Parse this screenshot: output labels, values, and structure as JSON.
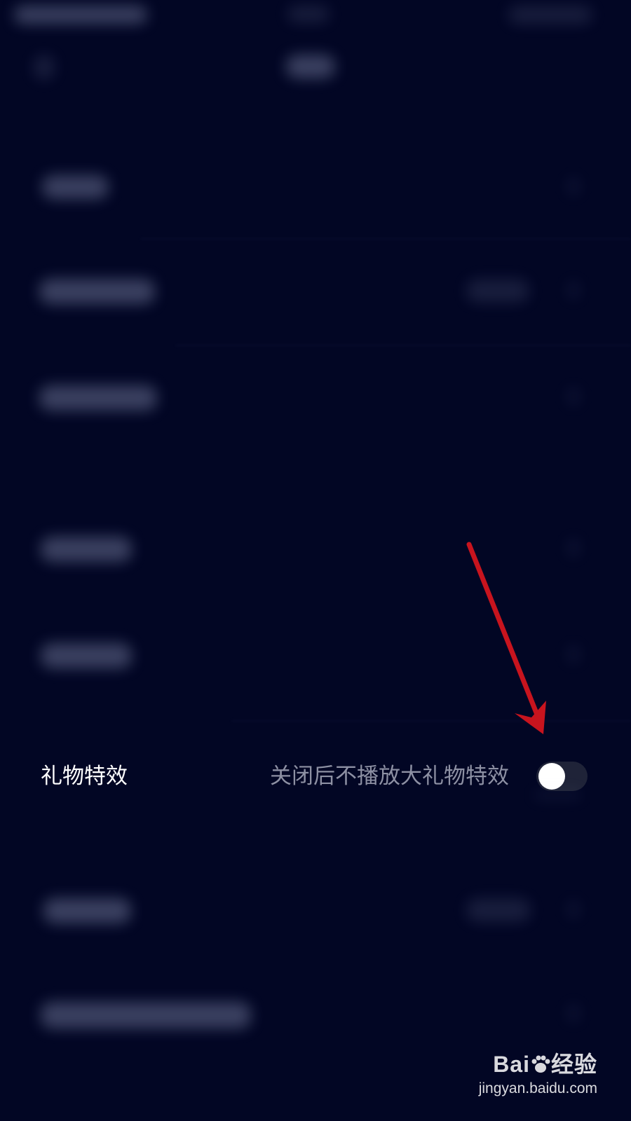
{
  "gift_effects": {
    "title": "礼物特效",
    "description": "关闭后不播放大礼物特效",
    "toggle_on": false
  },
  "watermark": {
    "brand": "Bai",
    "brand_suffix": "经验",
    "url": "jingyan.baidu.com"
  },
  "colors": {
    "background": "#020624",
    "title_text": "#ffffff",
    "description_text": "#8d90a3",
    "toggle_track_off": "#1f2338",
    "toggle_knob": "#ffffff",
    "annotation_arrow": "#c8141e"
  }
}
